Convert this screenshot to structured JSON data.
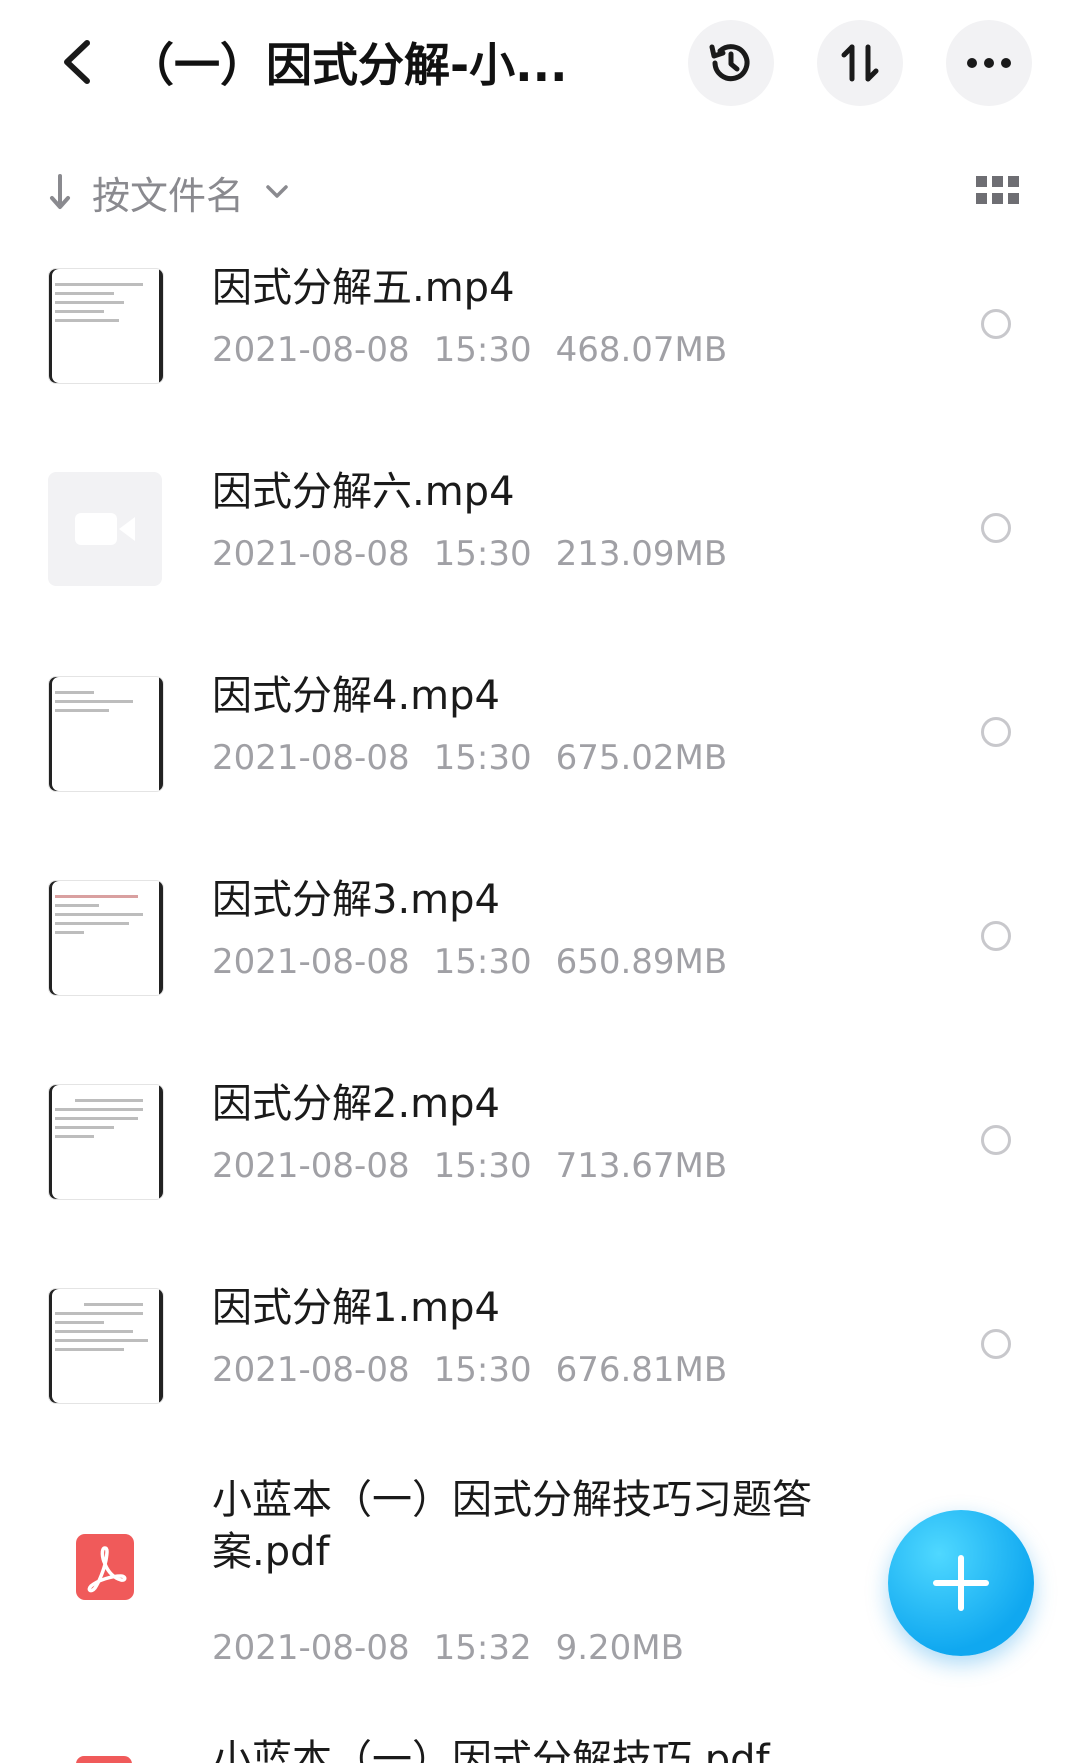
{
  "header": {
    "title": "（一）因式分解-小...",
    "back_icon": "chevron-left-icon",
    "history_icon": "history-icon",
    "sort_icon": "sort-order-icon",
    "more_icon": "more-horizontal-icon"
  },
  "sortbar": {
    "label": "按文件名",
    "arrow_icon": "arrow-down-icon",
    "chevron_icon": "chevron-down-icon",
    "view_icon": "grid-view-icon"
  },
  "files": [
    {
      "name": "因式分解五.mp4",
      "date": "2021-08-08",
      "time": "15:30",
      "size": "468.07MB",
      "thumb": "doc"
    },
    {
      "name": "因式分解六.mp4",
      "date": "2021-08-08",
      "time": "15:30",
      "size": "213.09MB",
      "thumb": "video"
    },
    {
      "name": "因式分解4.mp4",
      "date": "2021-08-08",
      "time": "15:30",
      "size": "675.02MB",
      "thumb": "doc"
    },
    {
      "name": "因式分解3.mp4",
      "date": "2021-08-08",
      "time": "15:30",
      "size": "650.89MB",
      "thumb": "doc"
    },
    {
      "name": "因式分解2.mp4",
      "date": "2021-08-08",
      "time": "15:30",
      "size": "713.67MB",
      "thumb": "doc"
    },
    {
      "name": "因式分解1.mp4",
      "date": "2021-08-08",
      "time": "15:30",
      "size": "676.81MB",
      "thumb": "doc"
    },
    {
      "name": "小蓝本（一）因式分解技巧习题答案.pdf",
      "date": "2021-08-08",
      "time": "15:32",
      "size": "9.20MB",
      "thumb": "pdf"
    }
  ],
  "partial_file": {
    "name": "小蓝本（一）因式分解技巧.pdf"
  },
  "fab": {
    "icon": "plus-icon"
  },
  "colors": {
    "accent": "#10a8f0",
    "pdf": "#f05a5a",
    "meta_text": "#a0a0a5"
  }
}
